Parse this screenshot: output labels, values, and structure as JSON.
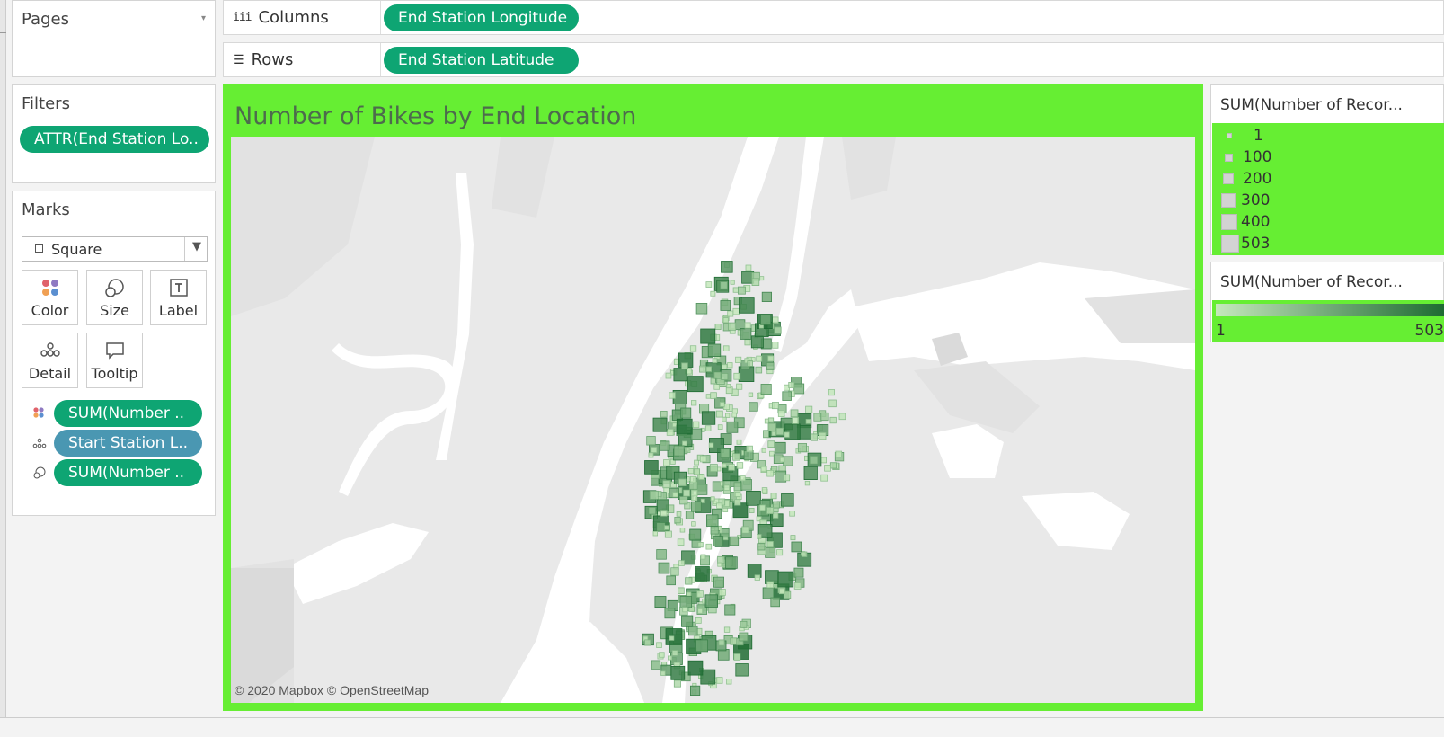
{
  "pages_panel": {
    "title": "Pages"
  },
  "filters_panel": {
    "title": "Filters",
    "pill": "ATTR(End Station Lo.."
  },
  "marks_panel": {
    "title": "Marks",
    "mark_type": "Square",
    "buttons": [
      "Color",
      "Size",
      "Label",
      "Detail",
      "Tooltip"
    ],
    "pills": [
      "SUM(Number ..",
      "Start Station L..",
      "SUM(Number .."
    ]
  },
  "shelves": {
    "columns_label": "Columns",
    "columns_pill": "End Station Longitude",
    "rows_label": "Rows",
    "rows_pill": "End Station Latitude"
  },
  "viz": {
    "title": "Number of Bikes by End Location",
    "attribution": "© 2020 Mapbox © OpenStreetMap"
  },
  "size_legend": {
    "title": "SUM(Number of Recor...",
    "items": [
      "1",
      "100",
      "200",
      "300",
      "400",
      "503"
    ]
  },
  "color_legend": {
    "title": "SUM(Number of Recor...",
    "min": "1",
    "max": "503",
    "colors": [
      "#c5e8bc",
      "#1e6b32"
    ]
  },
  "colors": {
    "panel_green": "#66ee33",
    "pill_green": "#0ea573",
    "pill_blue": "#4a97b2"
  }
}
